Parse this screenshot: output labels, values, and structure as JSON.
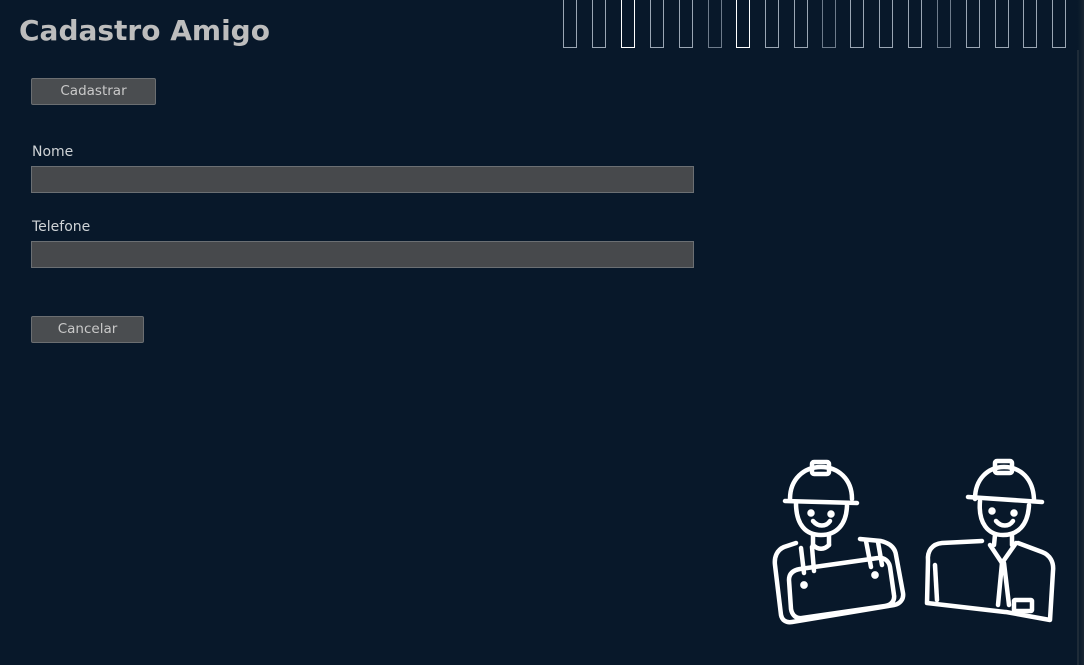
{
  "window": {
    "title": "Cadastro Amigo"
  },
  "form": {
    "submit_label": "Cadastrar",
    "cancel_label": "Cancelar",
    "fields": [
      {
        "label": "Nome",
        "value": "",
        "placeholder": ""
      },
      {
        "label": "Telefone",
        "value": "",
        "placeholder": ""
      }
    ]
  },
  "illustration": {
    "icon": "construction-workers-icon"
  },
  "colors": {
    "background": "#08182a",
    "field_background": "#47494c",
    "button_background": "#4a4d50",
    "title_text": "#bdbdbd",
    "label_text": "#cfd3d6",
    "illustration_stroke": "#ffffff"
  }
}
